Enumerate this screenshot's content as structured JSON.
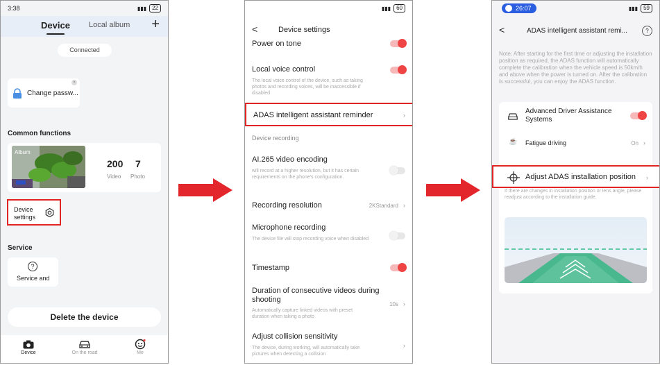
{
  "panel1": {
    "status": {
      "time": "3:38",
      "battery": "22"
    },
    "tabs": {
      "active": "Device",
      "inactive": "Local album"
    },
    "connection": "Connected",
    "change_password": "Change passw...",
    "common_functions_title": "Common functions",
    "album": {
      "label": "Album",
      "video_count": "200",
      "video_label": "Video",
      "photo_count": "7",
      "photo_label": "Photo"
    },
    "device_settings": "Device\nsettings",
    "service_title": "Service",
    "service_button": "Service and",
    "delete_button": "Delete the device",
    "nav": [
      {
        "label": "Device"
      },
      {
        "label": "On the road"
      },
      {
        "label": "Me"
      }
    ]
  },
  "panel2": {
    "status": {
      "battery": "60"
    },
    "title": "Device settings",
    "rows": {
      "power_on_tone": "Power on tone",
      "local_voice": "Local voice control",
      "local_voice_sub": "The local voice control of the device, such as taking photos and recording voices, will be inaccessible if disabled",
      "adas": "ADAS intelligent assistant reminder",
      "device_recording": "Device recording",
      "ai265": "AI.265 video encoding",
      "ai265_sub": "will record at a higher resolution, but it has certain requirements on the phone's configuration.",
      "resolution": "Recording resolution",
      "resolution_value": "2KStandard",
      "microphone": "Microphone recording",
      "microphone_sub": "The device file will stop recording voice when disabled",
      "timestamp": "Timestamp",
      "duration": "Duration of consecutive videos during shooting",
      "duration_sub": "Automatically capture linked videos with preset duration when taking a photo",
      "duration_value": "10s",
      "collision": "Adjust collision sensitivity",
      "collision_sub": "The device, during working, will automatically take pictures when detecting a collision"
    }
  },
  "panel3": {
    "status": {
      "time": "26:07",
      "battery": "59"
    },
    "title": "ADAS intelligent assistant remi...",
    "note": "Note: After starting for the first time or adjusting the installation position as required, the ADAS function will automatically complete the calibration when the vehicle speed is 50km/h and above when the power is turned on. After the calibration is successful, you can enjoy the ADAS function.",
    "adas_label": "Advanced Driver Assistance Systems",
    "fatigue": "Fatigue driving",
    "fatigue_value": "On",
    "adjust": "Adjust ADAS installation position",
    "adjust_note": "If there are changes in installation position or lens angle, please readjust according to the installation guide."
  },
  "colors": {
    "accent": "#ef4444",
    "highlight_border": "#e02424",
    "time_pill": "#2a5de0"
  }
}
